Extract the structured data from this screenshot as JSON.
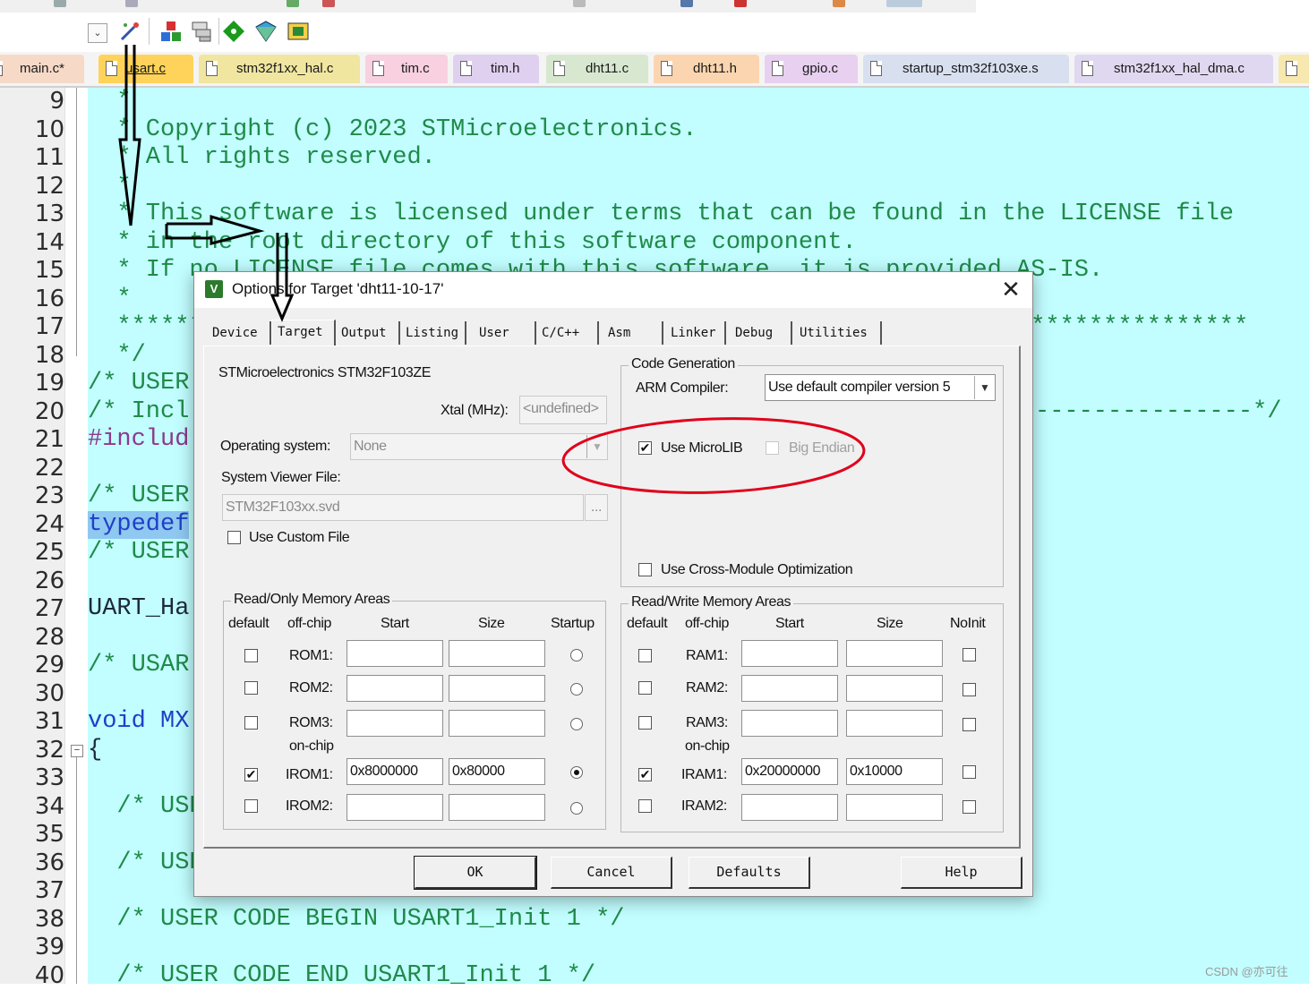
{
  "toolbar": {
    "combo_arrow": "⌄",
    "icons": [
      "wand-icon",
      "load-icon",
      "download-icon",
      "diamond-icon",
      "pack-icon",
      "board-icon"
    ]
  },
  "file_tabs": [
    {
      "label": "main.c*",
      "color": "#f7d9c8"
    },
    {
      "label": "usart.c",
      "color": "#ffd35a",
      "active": true
    },
    {
      "label": "stm32f1xx_hal.c",
      "color": "#f0e6a0"
    },
    {
      "label": "tim.c",
      "color": "#f8d0e0"
    },
    {
      "label": "tim.h",
      "color": "#e0d0f0"
    },
    {
      "label": "dht11.c",
      "color": "#d8e8d0"
    },
    {
      "label": "dht11.h",
      "color": "#fbd5b0"
    },
    {
      "label": "gpio.c",
      "color": "#e8d0f0"
    },
    {
      "label": "startup_stm32f103xe.s",
      "color": "#d8e0f0"
    },
    {
      "label": "stm32f1xx_hal_dma.c",
      "color": "#e0d8f0"
    }
  ],
  "editor": {
    "line_numbers": [
      "9",
      "10",
      "11",
      "12",
      "13",
      "14",
      "15",
      "16",
      "17",
      "18",
      "19",
      "20",
      "21",
      "22",
      "23",
      "24",
      "25",
      "26",
      "27",
      "28",
      "29",
      "30",
      "31",
      "32",
      "33",
      "34",
      "35",
      "36",
      "37",
      "38",
      "39",
      "40"
    ],
    "lines": [
      {
        "text": "  *",
        "style": "cm"
      },
      {
        "text": "  * Copyright (c) 2023 STMicroelectronics.",
        "style": "cm"
      },
      {
        "text": "  * All rights reserved.",
        "style": "cm"
      },
      {
        "text": "  *",
        "style": "cm"
      },
      {
        "text": "  * This software is licensed under terms that can be found in the LICENSE file",
        "style": "cm"
      },
      {
        "text": "  * in the root directory of this software component.",
        "style": "cm"
      },
      {
        "text": "  * If no LICENSE file comes with this software, it is provided AS-IS.",
        "style": "cm"
      },
      {
        "text": "  *",
        "style": "cm"
      },
      {
        "text": "  ******************************************************************************",
        "style": "cm"
      },
      {
        "text": "  */",
        "style": "cm"
      },
      {
        "text": "/* USER",
        "style": "cm"
      },
      {
        "text": "/* Incl",
        "style": "cm",
        "tail": "---------------*/"
      },
      {
        "text": "#includ",
        "style": "pp"
      },
      {
        "text": "",
        "style": "cm"
      },
      {
        "text": "/* USER",
        "style": "cm"
      },
      {
        "text": "typedef",
        "style": "kw",
        "highlight": true
      },
      {
        "text": "/* USER",
        "style": "cm"
      },
      {
        "text": "",
        "style": "cm"
      },
      {
        "text": "UART_Ha",
        "style": "id"
      },
      {
        "text": "",
        "style": "cm"
      },
      {
        "text": "/* USAR",
        "style": "cm"
      },
      {
        "text": "",
        "style": "cm"
      },
      {
        "text": "void MX",
        "style": "kw"
      },
      {
        "text": "{",
        "style": "id"
      },
      {
        "text": "",
        "style": "cm"
      },
      {
        "text": "  /* USE",
        "style": "cm"
      },
      {
        "text": "",
        "style": "cm"
      },
      {
        "text": "  /* USE",
        "style": "cm"
      },
      {
        "text": "",
        "style": "cm"
      },
      {
        "text": "  /* USER CODE BEGIN USART1_Init 1 */",
        "style": "cm"
      },
      {
        "text": "",
        "style": "cm"
      },
      {
        "text": "  /* USER CODE END USART1_Init 1 */",
        "style": "cm"
      }
    ]
  },
  "dialog": {
    "title": "Options for Target 'dht11-10-17'",
    "close_glyph": "✕",
    "logo": "V",
    "tabs": [
      "Device",
      "Target",
      "Output",
      "Listing",
      "User",
      "C/C++",
      "Asm",
      "Linker",
      "Debug",
      "Utilities"
    ],
    "selected_tab": "Target",
    "device_name": "STMicroelectronics STM32F103ZE",
    "xtal_label": "Xtal (MHz):",
    "xtal_value": "<undefined>",
    "os_label": "Operating system:",
    "os_value": "None",
    "svd_label": "System Viewer File:",
    "svd_value": "STM32F103xx.svd",
    "browse_label": "...",
    "use_custom_file": "Use Custom File",
    "code_generation": {
      "title": "Code Generation",
      "arm_compiler_label": "ARM Compiler:",
      "arm_compiler_value": "Use default compiler version 5",
      "use_microlib": "Use MicroLIB",
      "use_microlib_checked": true,
      "big_endian": "Big Endian",
      "cross_module": "Use Cross-Module Optimization"
    },
    "ro_memory": {
      "title": "Read/Only Memory Areas",
      "headers": [
        "default",
        "off-chip",
        "Start",
        "Size",
        "Startup"
      ],
      "on_chip_label": "on-chip",
      "rows": [
        {
          "name": "ROM1:",
          "start": "",
          "size": "",
          "default": false,
          "startup": false
        },
        {
          "name": "ROM2:",
          "start": "",
          "size": "",
          "default": false,
          "startup": false
        },
        {
          "name": "ROM3:",
          "start": "",
          "size": "",
          "default": false,
          "startup": false
        },
        {
          "name": "IROM1:",
          "start": "0x8000000",
          "size": "0x80000",
          "default": true,
          "startup": true
        },
        {
          "name": "IROM2:",
          "start": "",
          "size": "",
          "default": false,
          "startup": false
        }
      ]
    },
    "rw_memory": {
      "title": "Read/Write Memory Areas",
      "headers": [
        "default",
        "off-chip",
        "Start",
        "Size",
        "NoInit"
      ],
      "on_chip_label": "on-chip",
      "rows": [
        {
          "name": "RAM1:",
          "start": "",
          "size": "",
          "default": false,
          "noinit": false
        },
        {
          "name": "RAM2:",
          "start": "",
          "size": "",
          "default": false,
          "noinit": false
        },
        {
          "name": "RAM3:",
          "start": "",
          "size": "",
          "default": false,
          "noinit": false
        },
        {
          "name": "IRAM1:",
          "start": "0x20000000",
          "size": "0x10000",
          "default": true,
          "noinit": false
        },
        {
          "name": "IRAM2:",
          "start": "",
          "size": "",
          "default": false,
          "noinit": false
        }
      ]
    },
    "buttons": {
      "ok": "OK",
      "cancel": "Cancel",
      "defaults": "Defaults",
      "help": "Help"
    }
  },
  "colors": {
    "editor_bg": "#c2feff",
    "comment": "#1f8a4a",
    "keyword": "#1f3fc7",
    "annotation": "#e0001b"
  },
  "watermark": "CSDN @亦可往"
}
